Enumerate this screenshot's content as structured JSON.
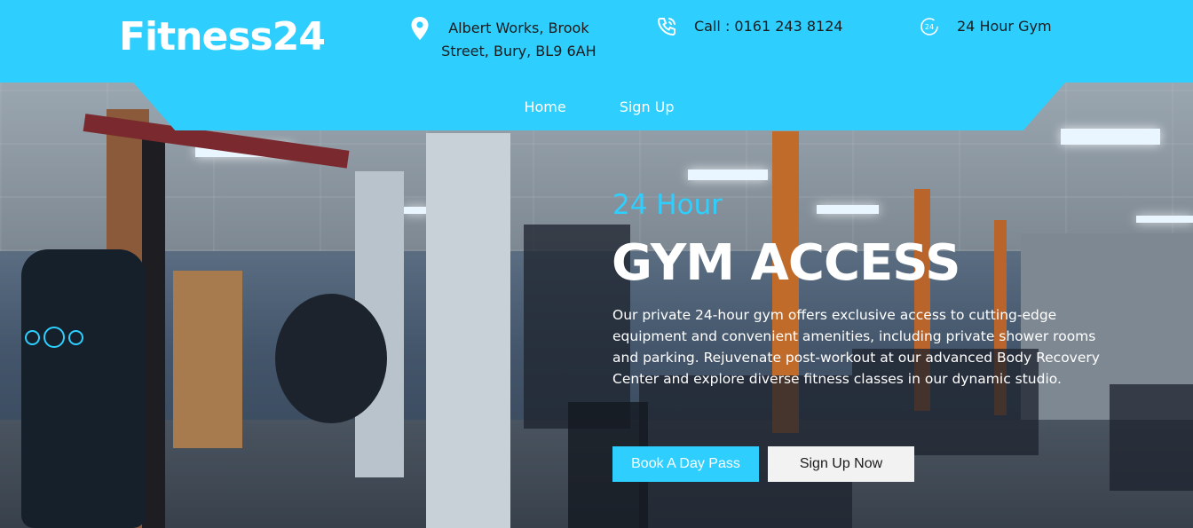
{
  "brand": {
    "logo_text": "Fitness24"
  },
  "header": {
    "address": "Albert Works, Brook Street, Bury, BL9 6AH",
    "phone": "Call : 0161 243 8124",
    "hours": "24 Hour Gym",
    "icons": {
      "address": "map-pin-icon",
      "phone": "phone-icon",
      "hours": "24-hour-icon"
    }
  },
  "nav": {
    "items": [
      {
        "label": "Home"
      },
      {
        "label": "Sign Up"
      }
    ]
  },
  "hero": {
    "subtitle": "24 Hour",
    "title": "GYM ACCESS",
    "description": "Our private 24-hour gym offers exclusive access to cutting-edge equipment and convenient amenities, including private shower rooms and parking. Rejuvenate post-workout at our advanced Body Recovery Center and explore diverse fitness classes in our dynamic studio.",
    "primary_button": "Book A Day Pass",
    "secondary_button": "Sign Up Now"
  },
  "slider": {
    "count": 3,
    "active_index": 1
  },
  "colors": {
    "accent": "#2ecfff",
    "white": "#ffffff",
    "text_dark": "#1b1b1b"
  }
}
